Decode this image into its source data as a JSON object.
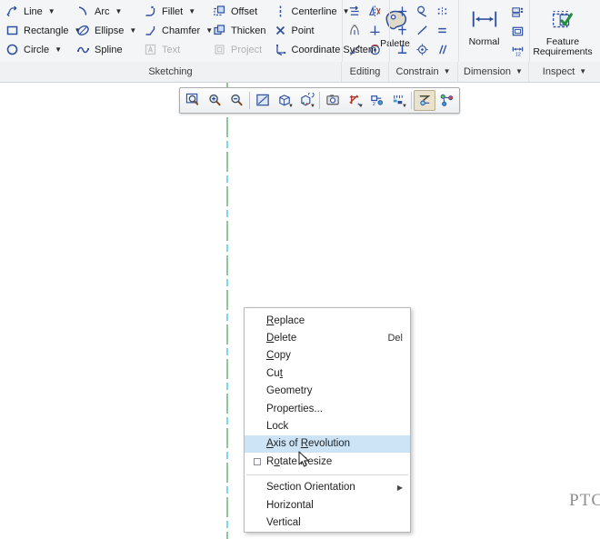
{
  "ribbon": {
    "groups": [
      {
        "name": "sketching",
        "footer_label": "Sketching",
        "has_footer_caret": false,
        "columns": [
          {
            "items": [
              {
                "label": "Line",
                "icon": "line-icon",
                "caret": true,
                "disabled": false
              },
              {
                "label": "Rectangle",
                "icon": "rectangle-icon",
                "caret": true,
                "disabled": false
              },
              {
                "label": "Circle",
                "icon": "circle-icon",
                "caret": true,
                "disabled": false
              }
            ]
          },
          {
            "items": [
              {
                "label": "Arc",
                "icon": "arc-icon",
                "caret": true,
                "disabled": false
              },
              {
                "label": "Ellipse",
                "icon": "ellipse-icon",
                "caret": true,
                "disabled": false
              },
              {
                "label": "Spline",
                "icon": "spline-icon",
                "caret": false,
                "disabled": false
              }
            ]
          },
          {
            "items": [
              {
                "label": "Fillet",
                "icon": "fillet-icon",
                "caret": true,
                "disabled": false
              },
              {
                "label": "Chamfer",
                "icon": "chamfer-icon",
                "caret": true,
                "disabled": false
              },
              {
                "label": "Text",
                "icon": "text-icon",
                "caret": false,
                "disabled": true
              }
            ]
          },
          {
            "items": [
              {
                "label": "Offset",
                "icon": "offset-icon",
                "caret": false,
                "disabled": false
              },
              {
                "label": "Thicken",
                "icon": "thicken-icon",
                "caret": false,
                "disabled": false
              },
              {
                "label": "Project",
                "icon": "project-icon",
                "caret": false,
                "disabled": true
              }
            ]
          },
          {
            "items": [
              {
                "label": "Centerline",
                "icon": "centerline-icon",
                "caret": true,
                "disabled": false
              },
              {
                "label": "Point",
                "icon": "point-icon",
                "caret": false,
                "disabled": false
              },
              {
                "label": "Coordinate System",
                "icon": "coordinate-system-icon",
                "caret": false,
                "disabled": false
              }
            ]
          }
        ],
        "big_buttons": [
          {
            "label": "Palette",
            "icon": "palette-icon"
          }
        ]
      },
      {
        "name": "editing",
        "footer_label": "Editing",
        "has_footer_caret": false,
        "icon_grid": [
          [
            "modify-icon",
            "mirror-icon"
          ],
          [
            "divide-icon",
            "trim-corner-icon"
          ],
          [
            "delete-segment-icon",
            "rotate-resize-icon"
          ]
        ]
      },
      {
        "name": "constrain",
        "footer_label": "Constrain",
        "has_footer_caret": true,
        "icon_grid": [
          [
            "vertical-constraint-icon",
            "tangent-constraint-icon",
            "symmetric-constraint-icon"
          ],
          [
            "horizontal-constraint-icon",
            "midpoint-constraint-icon",
            "equal-constraint-icon"
          ],
          [
            "perpendicular-constraint-icon",
            "coincident-constraint-icon",
            "parallel-constraint-icon"
          ]
        ]
      },
      {
        "name": "dimension",
        "footer_label": "Dimension",
        "has_footer_caret": true,
        "big_buttons": [
          {
            "label": "Normal",
            "icon": "normal-dimension-icon"
          }
        ],
        "icon_grid": [
          [
            "baseline-dimension-icon"
          ],
          [
            "reference-dimension-icon"
          ],
          [
            "modify-dimension-icon"
          ]
        ]
      },
      {
        "name": "inspect",
        "footer_label": "Inspect",
        "has_footer_caret": true,
        "big_buttons": [
          {
            "label": "Feature Requirements",
            "icon": "feature-requirements-icon"
          }
        ]
      }
    ]
  },
  "view_toolbar": {
    "buttons": [
      {
        "name": "refit-icon",
        "label": "Refit",
        "caret": false,
        "active": false
      },
      {
        "name": "zoom-in-icon",
        "label": "Zoom In",
        "caret": false,
        "active": false
      },
      {
        "name": "zoom-out-icon",
        "label": "Zoom Out",
        "caret": false,
        "active": false
      },
      {
        "name": "repaint-icon",
        "label": "Repaint",
        "caret": false,
        "active": false
      },
      {
        "name": "display-style-icon",
        "label": "Display Style",
        "caret": true,
        "active": false
      },
      {
        "name": "saved-orientations-icon",
        "label": "Saved Orientations",
        "caret": true,
        "active": false
      },
      {
        "name": "view-manager-icon",
        "label": "View Manager",
        "caret": false,
        "active": false
      },
      {
        "name": "datum-display-icon",
        "label": "Datum Display Filters",
        "caret": true,
        "active": false
      },
      {
        "name": "annotation-display-icon",
        "label": "Annotation Display",
        "caret": false,
        "active": false
      },
      {
        "name": "spin-center-icon",
        "label": "Spin Center",
        "caret": true,
        "active": false
      },
      {
        "name": "sketch-display-icon",
        "label": "Sketch Display Filters",
        "caret": false,
        "active": true
      },
      {
        "name": "sketch-view-icon",
        "label": "Sketch View",
        "caret": false,
        "active": false
      }
    ]
  },
  "canvas": {
    "watermark": "PTC",
    "centerline_color": "#8fc79a",
    "centerline_highlight_color": "#7fd8f0"
  },
  "context_menu": {
    "highlight_color": "#cde4f7",
    "items": [
      {
        "label": "Replace",
        "mnemonic_index": 2,
        "accel": "",
        "type": "item",
        "highlighted": false,
        "checkbox": false,
        "submenu": false
      },
      {
        "label": "Delete",
        "mnemonic_index": 0,
        "accel": "Del",
        "type": "item",
        "highlighted": false,
        "checkbox": false,
        "submenu": false
      },
      {
        "label": "Copy",
        "mnemonic_index": 0,
        "accel": "",
        "type": "item",
        "highlighted": false,
        "checkbox": false,
        "submenu": false
      },
      {
        "label": "Cut",
        "mnemonic_index": 2,
        "accel": "",
        "type": "item",
        "highlighted": false,
        "checkbox": false,
        "submenu": false
      },
      {
        "label": "Geometry",
        "mnemonic_index": -1,
        "accel": "",
        "type": "item",
        "highlighted": false,
        "checkbox": false,
        "submenu": false
      },
      {
        "label": "Properties...",
        "mnemonic_index": -1,
        "accel": "",
        "type": "item",
        "highlighted": false,
        "checkbox": false,
        "submenu": false
      },
      {
        "label": "Lock",
        "mnemonic_index": -1,
        "accel": "",
        "type": "item",
        "highlighted": false,
        "checkbox": false,
        "submenu": false
      },
      {
        "label": "Axis of Revolution",
        "mnemonic_index": 0,
        "accel": "",
        "type": "item",
        "highlighted": true,
        "checkbox": false,
        "submenu": false
      },
      {
        "label": "Rotate Resize",
        "mnemonic_index": 2,
        "accel": "",
        "type": "item",
        "highlighted": false,
        "checkbox": true,
        "submenu": false
      },
      {
        "type": "separator"
      },
      {
        "label": "Section Orientation",
        "mnemonic_index": -1,
        "accel": "",
        "type": "item",
        "highlighted": false,
        "checkbox": false,
        "submenu": true
      },
      {
        "label": "Horizontal",
        "mnemonic_index": -1,
        "accel": "",
        "type": "item",
        "highlighted": false,
        "checkbox": false,
        "submenu": false
      },
      {
        "label": "Vertical",
        "mnemonic_index": -1,
        "accel": "",
        "type": "item",
        "highlighted": false,
        "checkbox": false,
        "submenu": false
      }
    ]
  }
}
